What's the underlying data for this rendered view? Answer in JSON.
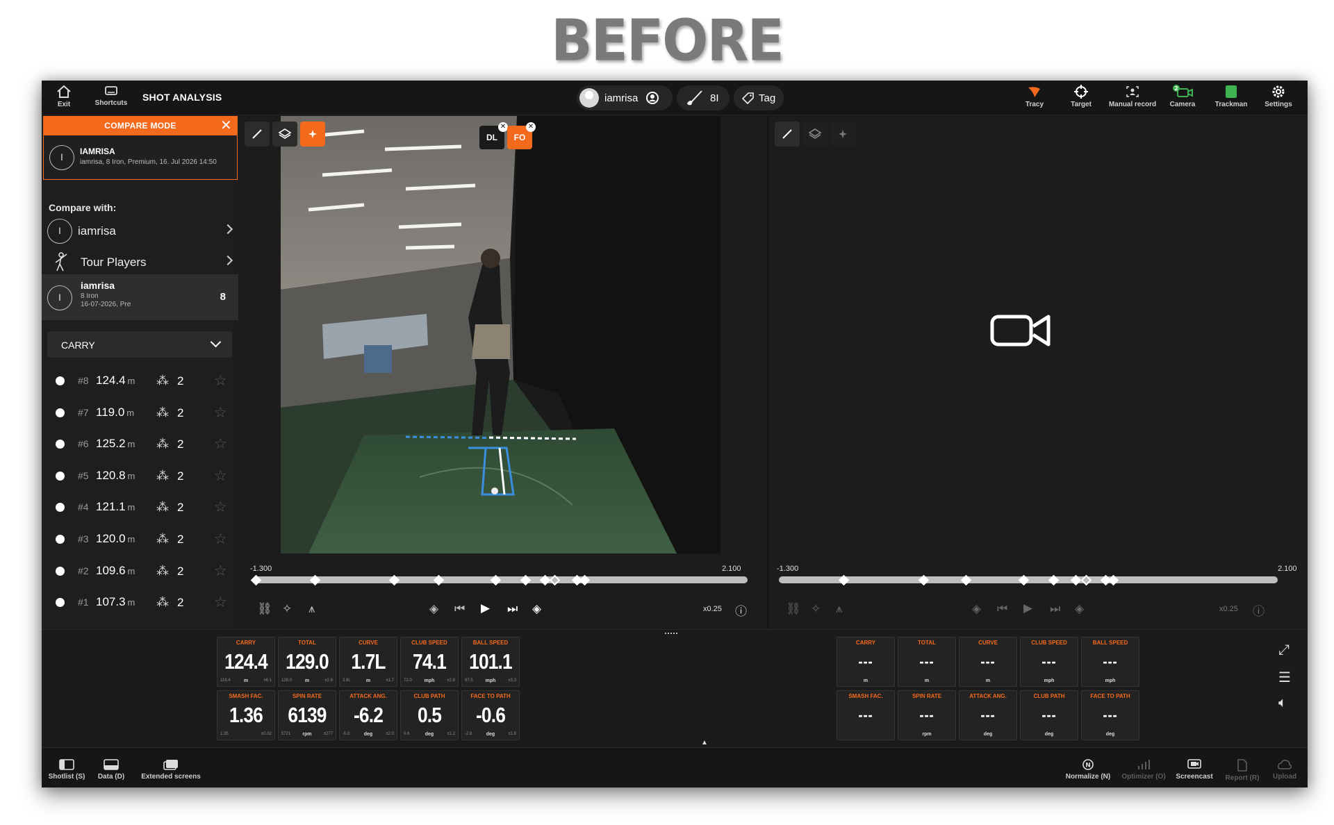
{
  "heading": "BEFORE",
  "topbar": {
    "exit": "Exit",
    "shortcuts": "Shortcuts",
    "title": "SHOT ANALYSIS",
    "user": "iamrisa",
    "club": "8I",
    "tag": "Tag",
    "right": [
      {
        "label": "Tracy",
        "icon": "tracy-icon"
      },
      {
        "label": "Target",
        "icon": "target-icon"
      },
      {
        "label": "Manual record",
        "icon": "manual-record-icon"
      },
      {
        "label": "Camera",
        "icon": "camera-icon",
        "badge": "2"
      },
      {
        "label": "Trackman",
        "icon": "trackman-icon"
      },
      {
        "label": "Settings",
        "icon": "gear-icon"
      }
    ],
    "accent": "#f46a1c",
    "green": "#3fb34f"
  },
  "sidebar": {
    "compare_mode": "COMPARE MODE",
    "current": {
      "initial": "I",
      "name": "IAMRISA",
      "detail": "iamrisa, 8 Iron, Premium, 16. Jul 2026 14:50"
    },
    "compare_with": "Compare with:",
    "options": [
      {
        "initial": "I",
        "label": "iamrisa"
      },
      {
        "label": "Tour Players",
        "icon": "golfer-icon"
      }
    ],
    "selected": {
      "initial": "I",
      "name": "iamrisa",
      "club": "8 Iron",
      "date": "16-07-2026, Pre",
      "count": "8"
    },
    "metric": "CARRY",
    "shots": [
      {
        "num": "#8",
        "value": "124.4",
        "unit": "m",
        "count": "2"
      },
      {
        "num": "#7",
        "value": "119.0",
        "unit": "m",
        "count": "2"
      },
      {
        "num": "#6",
        "value": "125.2",
        "unit": "m",
        "count": "2"
      },
      {
        "num": "#5",
        "value": "120.8",
        "unit": "m",
        "count": "2"
      },
      {
        "num": "#4",
        "value": "121.1",
        "unit": "m",
        "count": "2"
      },
      {
        "num": "#3",
        "value": "120.0",
        "unit": "m",
        "count": "2"
      },
      {
        "num": "#2",
        "value": "109.6",
        "unit": "m",
        "count": "2"
      },
      {
        "num": "#1",
        "value": "107.3",
        "unit": "m",
        "count": "2"
      }
    ]
  },
  "left_video": {
    "badges": [
      "DL",
      "FO"
    ],
    "t_start": "-1.300",
    "t_end": "2.100",
    "speed": "x0.25"
  },
  "right_video": {
    "t_start": "-1.300",
    "t_end": "2.100",
    "speed": "x0.25"
  },
  "metrics_left": {
    "row1": [
      {
        "title": "CARRY",
        "value": "124.4",
        "unit": "m",
        "low": "118.4",
        "high": "±6.1"
      },
      {
        "title": "TOTAL",
        "value": "129.0",
        "unit": "m",
        "low": "128.0",
        "high": "±2.6"
      },
      {
        "title": "CURVE",
        "value": "1.7L",
        "unit": "m",
        "low": "3.8L",
        "high": "±1.7"
      },
      {
        "title": "CLUB SPEED",
        "value": "74.1",
        "unit": "mph",
        "low": "72.0",
        "high": "±2.8"
      },
      {
        "title": "BALL SPEED",
        "value": "101.1",
        "unit": "mph",
        "low": "97.5",
        "high": "±3.3"
      }
    ],
    "row2": [
      {
        "title": "SMASH FAC.",
        "value": "1.36",
        "unit": "",
        "low": "1.35",
        "high": "±0.02"
      },
      {
        "title": "SPIN RATE",
        "value": "6139",
        "unit": "rpm",
        "low": "5721",
        "high": "±277"
      },
      {
        "title": "ATTACK ANG.",
        "value": "-6.2",
        "unit": "deg",
        "low": "-5.0",
        "high": "±2.0"
      },
      {
        "title": "CLUB PATH",
        "value": "0.5",
        "unit": "deg",
        "low": "0.6",
        "high": "±1.2"
      },
      {
        "title": "FACE TO PATH",
        "value": "-0.6",
        "unit": "deg",
        "low": "-2.8",
        "high": "±1.9"
      }
    ]
  },
  "metrics_right": {
    "row1": [
      {
        "title": "CARRY",
        "value": "---",
        "unit": "m"
      },
      {
        "title": "TOTAL",
        "value": "---",
        "unit": "m"
      },
      {
        "title": "CURVE",
        "value": "---",
        "unit": "m"
      },
      {
        "title": "CLUB SPEED",
        "value": "---",
        "unit": "mph"
      },
      {
        "title": "BALL SPEED",
        "value": "---",
        "unit": "mph"
      }
    ],
    "row2": [
      {
        "title": "SMASH FAC.",
        "value": "---",
        "unit": ""
      },
      {
        "title": "SPIN RATE",
        "value": "---",
        "unit": "rpm"
      },
      {
        "title": "ATTACK ANG.",
        "value": "---",
        "unit": "deg"
      },
      {
        "title": "CLUB PATH",
        "value": "---",
        "unit": "deg"
      },
      {
        "title": "FACE TO PATH",
        "value": "---",
        "unit": "deg"
      }
    ]
  },
  "bottombar": {
    "left": [
      {
        "label": "Shotlist (S)",
        "icon": "shotlist-icon"
      },
      {
        "label": "Data (D)",
        "icon": "data-icon"
      },
      {
        "label": "Extended screens",
        "icon": "extended-screens-icon"
      }
    ],
    "right": [
      {
        "label": "Normalize (N)",
        "icon": "normalize-icon",
        "enabled": true
      },
      {
        "label": "Optimizer (O)",
        "icon": "optimizer-icon",
        "enabled": false
      },
      {
        "label": "Screencast",
        "icon": "screencast-icon",
        "enabled": true
      },
      {
        "label": "Report (R)",
        "icon": "report-icon",
        "enabled": false
      },
      {
        "label": "Upload",
        "icon": "upload-icon",
        "enabled": false
      }
    ]
  }
}
